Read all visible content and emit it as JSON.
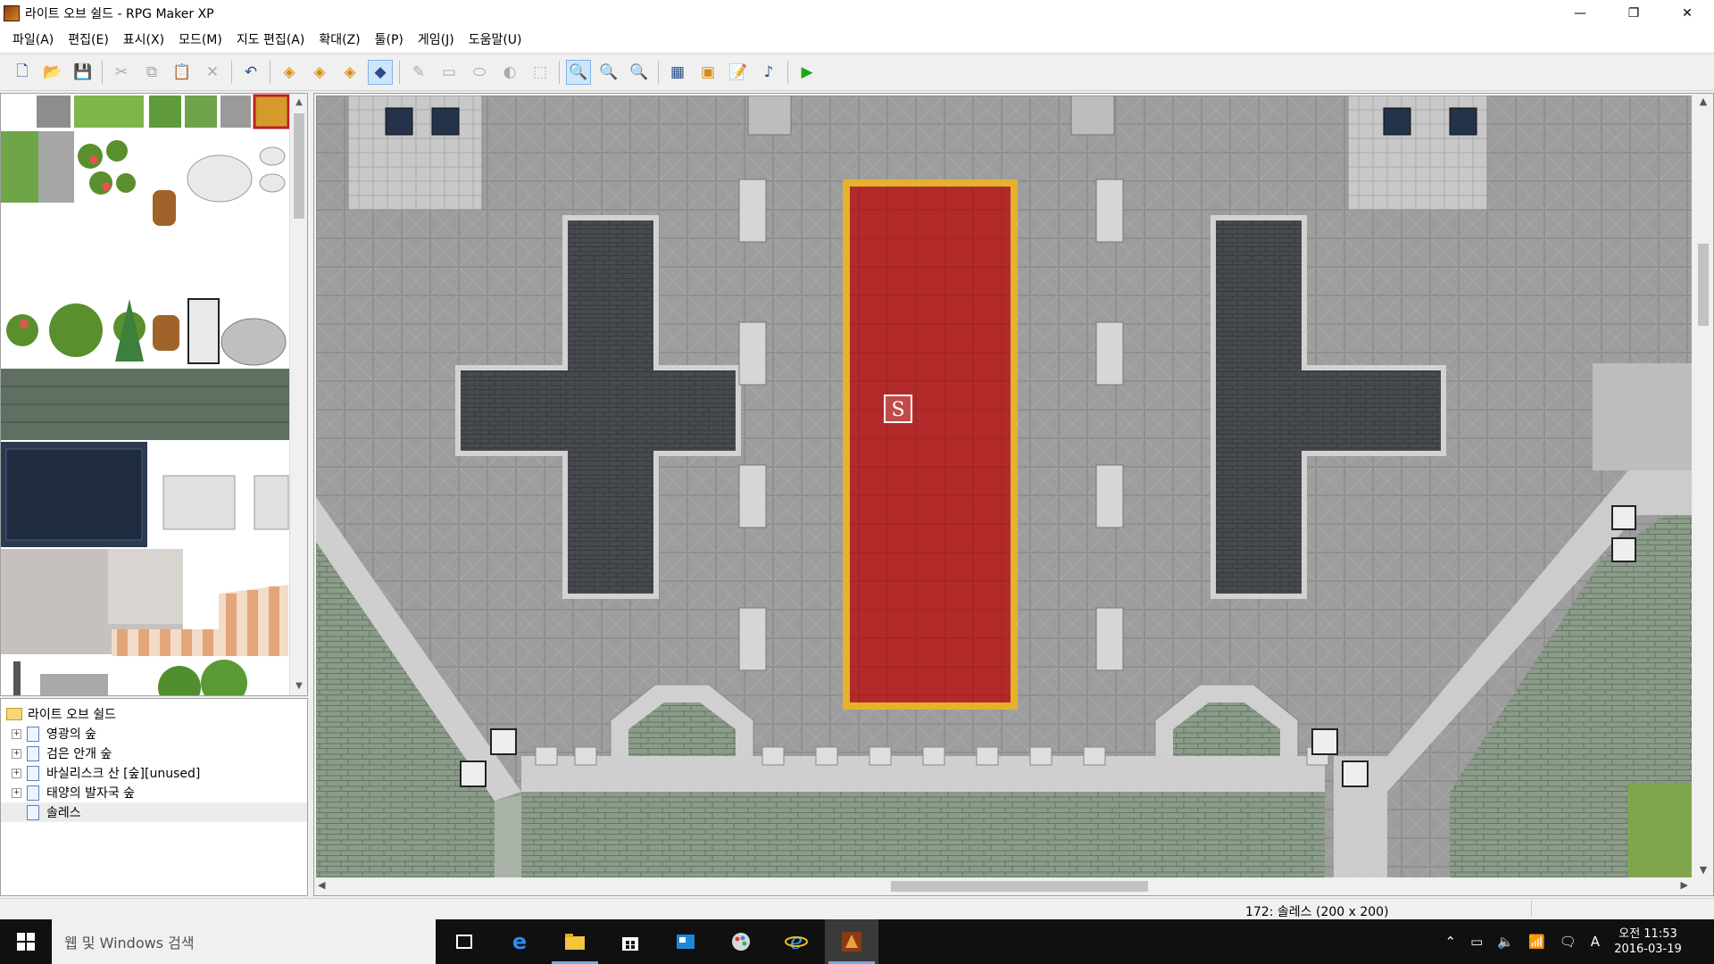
{
  "window": {
    "title": "라이트 오브 쉴드 - RPG Maker XP",
    "controls": {
      "minimize": "—",
      "maximize": "❐",
      "close": "✕"
    }
  },
  "menu": [
    "파일(A)",
    "편집(E)",
    "표시(X)",
    "모드(M)",
    "지도 편집(A)",
    "확대(Z)",
    "툴(P)",
    "게임(J)",
    "도움말(U)"
  ],
  "toolbar": {
    "icons": [
      "new-project-icon",
      "open-project-icon",
      "save-icon",
      "cut-icon",
      "copy-icon",
      "paste-icon",
      "delete-icon",
      "undo-icon",
      "layer1-icon",
      "layer2-icon",
      "layer3-icon",
      "event-layer-icon",
      "pencil-icon",
      "rectangle-icon",
      "ellipse-icon",
      "fill-icon",
      "select-icon",
      "zoom-1-icon",
      "zoom-2-icon",
      "zoom-4-icon",
      "database-icon",
      "resource-icon",
      "script-icon",
      "sound-test-icon",
      "play-test-icon"
    ]
  },
  "tree": {
    "root": "라이트 오브 쉴드",
    "items": [
      {
        "label": "영광의 숲",
        "expandable": true
      },
      {
        "label": "검은 안개 숲",
        "expandable": true
      },
      {
        "label": "바실리스크 산 [숲][unused]",
        "expandable": true
      },
      {
        "label": "태양의 발자국 숲",
        "expandable": true
      },
      {
        "label": "솔레스",
        "expandable": false,
        "selected": true
      }
    ]
  },
  "map": {
    "start_marker": "S",
    "colors": {
      "floor": "#9d9d9d",
      "carpet": "#b32a2a",
      "carpet_border": "#e4b22c",
      "pool": "#474a4f",
      "wall": "#c9c9c9",
      "grass": "#7fa64b"
    }
  },
  "status": {
    "map_info": "172: 솔레스 (200 x 200)"
  },
  "taskbar": {
    "search_placeholder": "웹 및 Windows 검색",
    "clock_time": "오전 11:53",
    "clock_date": "2016-03-19",
    "ime": "A"
  }
}
